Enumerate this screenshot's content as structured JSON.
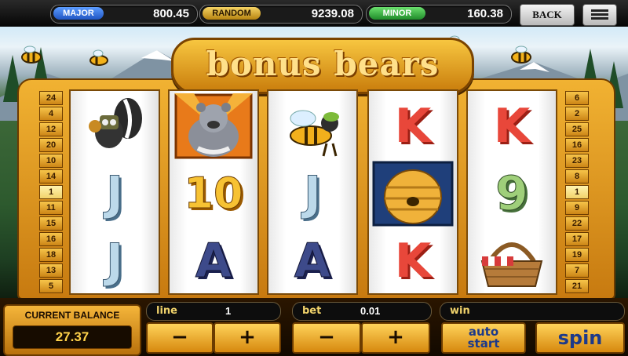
{
  "jackpots": [
    {
      "label": "MAJOR",
      "value": "800.45",
      "color": "#2f6fd6"
    },
    {
      "label": "RANDOM",
      "value": "9239.08",
      "color": "#c69514"
    },
    {
      "label": "MINOR",
      "value": "160.38",
      "color": "#35a83a"
    }
  ],
  "header": {
    "back_label": "BACK",
    "menu_icon": "hamburger-menu-icon"
  },
  "game": {
    "title": "bonus bears"
  },
  "paylines_left": [
    "24",
    "4",
    "12",
    "20",
    "10",
    "14",
    "1",
    "11",
    "15",
    "16",
    "18",
    "13",
    "5"
  ],
  "paylines_right": [
    "6",
    "2",
    "25",
    "16",
    "23",
    "8",
    "1",
    "9",
    "22",
    "17",
    "19",
    "7",
    "21"
  ],
  "reels": [
    [
      "skunk",
      "J",
      "J"
    ],
    [
      "bear",
      "10",
      "A"
    ],
    [
      "bee",
      "J",
      "A"
    ],
    [
      "K",
      "beehive",
      "K"
    ],
    [
      "K",
      "9",
      "picnic-basket"
    ]
  ],
  "balance": {
    "label": "CURRENT BALANCE",
    "value": "27.37"
  },
  "controls": {
    "line_label": "line",
    "line_value": "1",
    "bet_label": "bet",
    "bet_value": "0.01",
    "win_label": "win",
    "win_value": "",
    "minus": "−",
    "plus": "+",
    "auto_line1": "auto",
    "auto_line2": "start",
    "spin": "spin"
  }
}
